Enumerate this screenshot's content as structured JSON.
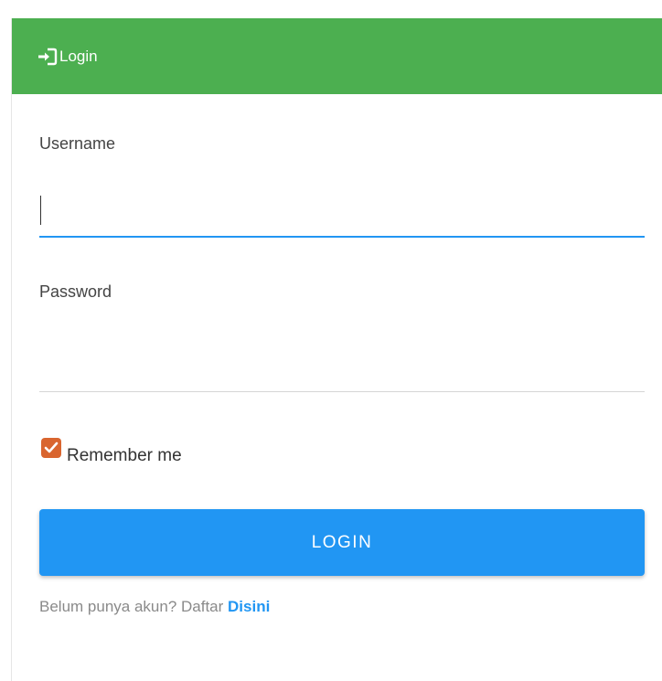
{
  "header": {
    "title": "Login",
    "icon": "sign-in-icon",
    "color": "#4caf50"
  },
  "form": {
    "username_label": "Username",
    "username_value": "",
    "password_label": "Password",
    "password_value": "",
    "remember_label": "Remember me",
    "remember_checked": true,
    "submit_label": "LOGIN"
  },
  "signup": {
    "prompt": "Belum punya akun? Daftar ",
    "link_label": "Disini"
  },
  "colors": {
    "accent": "#2196f3",
    "checkbox": "#d9652f"
  }
}
